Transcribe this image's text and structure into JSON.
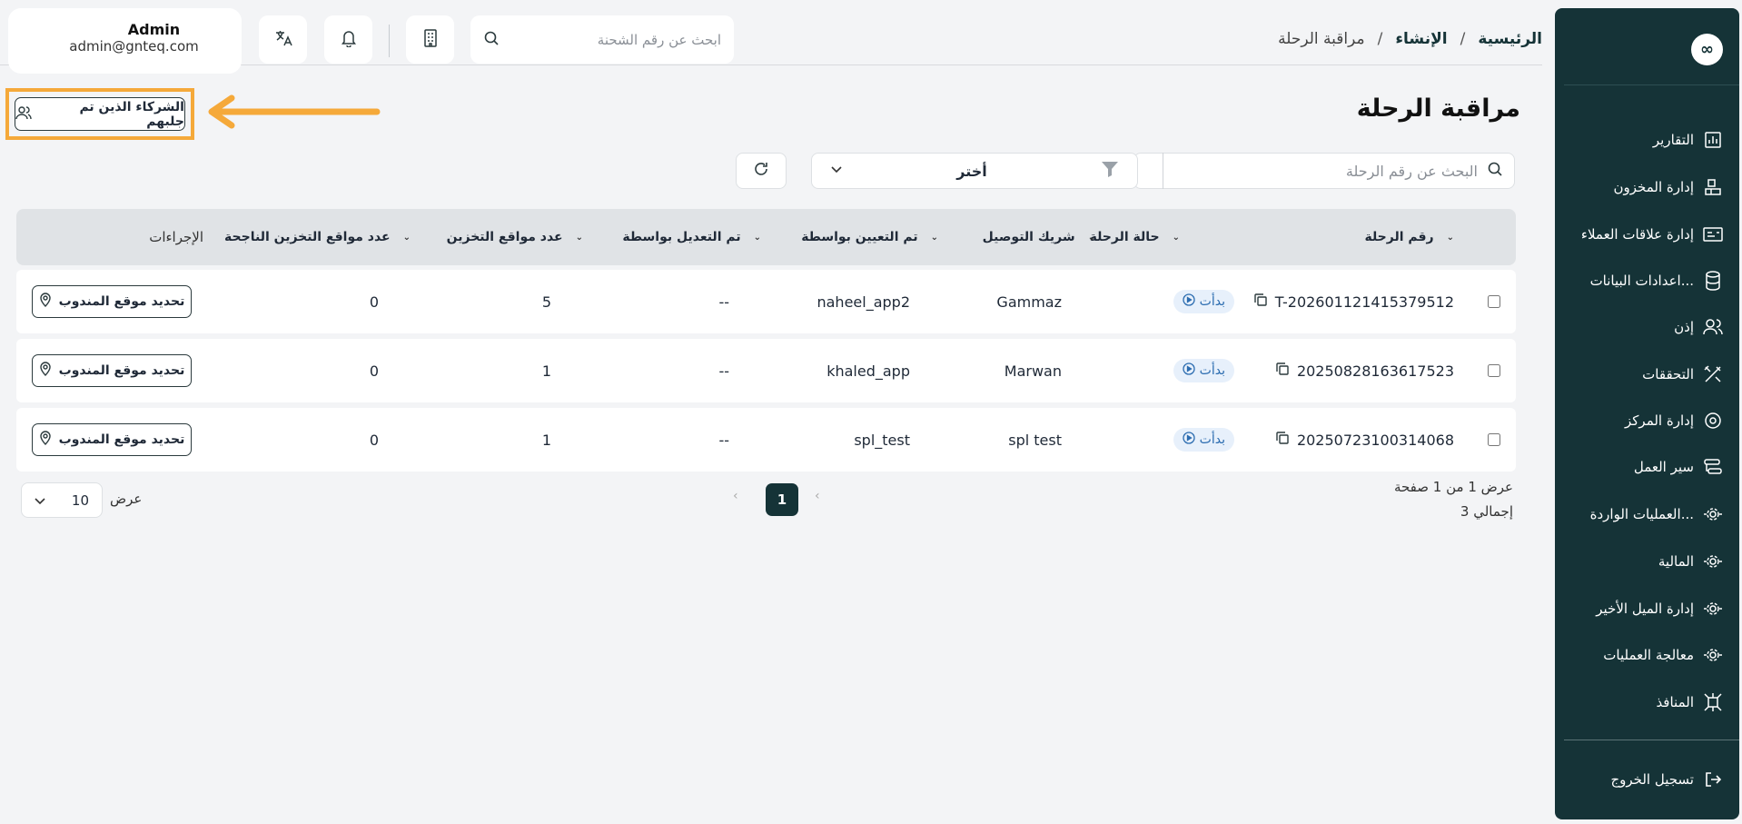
{
  "header": {
    "breadcrumb": [
      "الرئيسية",
      "الإنشاء",
      "مراقبة الرحلة"
    ],
    "breadcrumb_sep": "/",
    "shipment_search_placeholder": "ابحث عن رقم الشحنة",
    "user": {
      "name": "Admin",
      "email": "admin@gnteq.com"
    }
  },
  "sidebar": {
    "logo": "∞",
    "items": [
      {
        "label": "التقارير",
        "icon": "chart-icon"
      },
      {
        "label": "إدارة المخزون",
        "icon": "inventory-icon"
      },
      {
        "label": "إدارة علاقات العملاء",
        "icon": "crm-icon"
      },
      {
        "label": "اعدادات البيانات...",
        "icon": "database-icon"
      },
      {
        "label": "إذن",
        "icon": "users-icon"
      },
      {
        "label": "التحققات",
        "icon": "tools-icon"
      },
      {
        "label": "إدارة المركز",
        "icon": "hub-settings-icon"
      },
      {
        "label": "سير العمل",
        "icon": "workflow-icon"
      },
      {
        "label": "العمليات الواردة...",
        "icon": "gear-icon"
      },
      {
        "label": "المالية",
        "icon": "gear-icon"
      },
      {
        "label": "إدارة الميل الأخير",
        "icon": "gear-icon"
      },
      {
        "label": "معالجة العمليات",
        "icon": "gear-icon"
      },
      {
        "label": "المنافذ",
        "icon": "network-icon"
      }
    ],
    "logout": "تسجيل الخروج"
  },
  "page": {
    "title": "مراقبة الرحلة",
    "attracted_partners_label": "الشركاء الذين تم جلبهم",
    "trip_search_placeholder": "البحث عن رقم الرحلة",
    "filter_select_value": "أختر"
  },
  "table": {
    "columns": [
      "رقم الرحلة",
      "حالة الرحلة",
      "شريك التوصيل",
      "تم التعيين بواسطة",
      "تم التعديل بواسطة",
      "عدد مواقع التخزين",
      "عدد مواقع التخزين الناجحة",
      "الإجراءات"
    ],
    "rows": [
      {
        "trip": "T-202601121415379512",
        "status": "بدأت",
        "partner": "Gammaz",
        "assigned_by": "naheel_app2",
        "modified_by": "--",
        "storage_count": "5",
        "storage_success": "0",
        "action": "تحديد موقع المندوب"
      },
      {
        "trip": "20250828163617523",
        "status": "بدأت",
        "partner": "Marwan",
        "assigned_by": "khaled_app",
        "modified_by": "--",
        "storage_count": "1",
        "storage_success": "0",
        "action": "تحديد موقع المندوب"
      },
      {
        "trip": "20250723100314068",
        "status": "بدأت",
        "partner": "spl test",
        "assigned_by": "spl_test",
        "modified_by": "--",
        "storage_count": "1",
        "storage_success": "0",
        "action": "تحديد موقع المندوب"
      }
    ]
  },
  "pagination": {
    "showing": "عرض 1 من 1 صفحة",
    "total": "إجمالي 3",
    "current_page": "1",
    "per_page_label": "عرض",
    "per_page_value": "10"
  },
  "colors": {
    "sidebar_bg": "#153337",
    "accent_highlight": "#f5a93a",
    "status_blue": "#2b6cb0"
  }
}
